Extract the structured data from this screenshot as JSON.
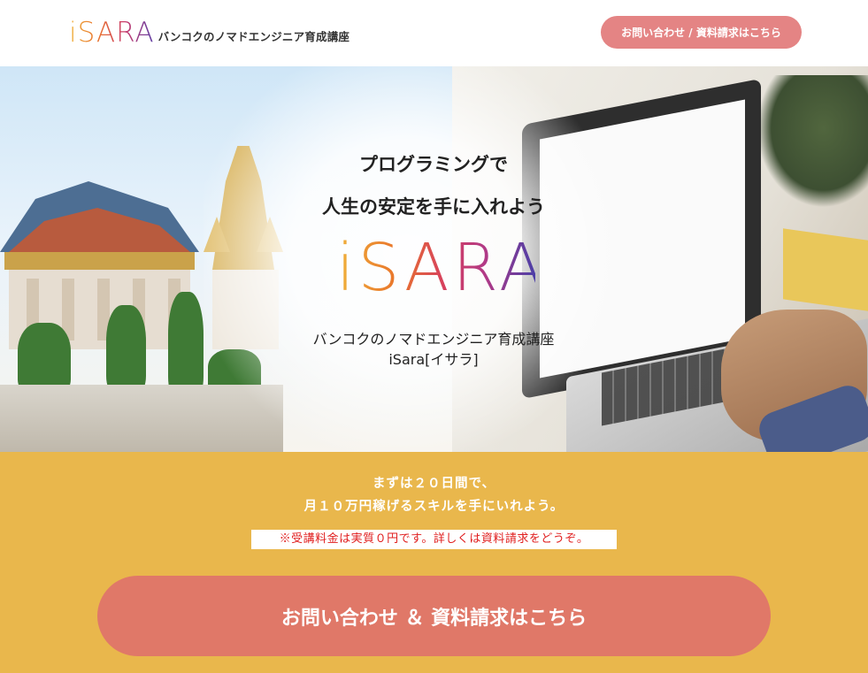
{
  "header": {
    "logo_mark": "iSARA",
    "logo_tagline": "バンコクのノマドエンジニア育成講座",
    "cta_label": "お問い合わせ / 資料請求はこちら"
  },
  "hero": {
    "headline_line1": "プログラミングで",
    "headline_line2": "人生の安定を手に入れよう",
    "brand": "iSARA",
    "school_name": "バンコクのノマドエンジニア育成講座",
    "school_name_sub": "iSara[イサラ]"
  },
  "cta_section": {
    "line1": "まずは２０日間で、",
    "line2": "月１０万円稼げるスキルを手にいれよう。",
    "notice": "※受講料金は実質０円です。詳しくは資料請求をどうぞ。",
    "button_label": "お問い合わせ ＆ 資料請求はこちら"
  },
  "colors": {
    "header_cta_bg": "#e48484",
    "cta_section_bg": "#e9b74c",
    "big_cta_bg": "#e07868",
    "notice_text": "#e01e1e"
  }
}
